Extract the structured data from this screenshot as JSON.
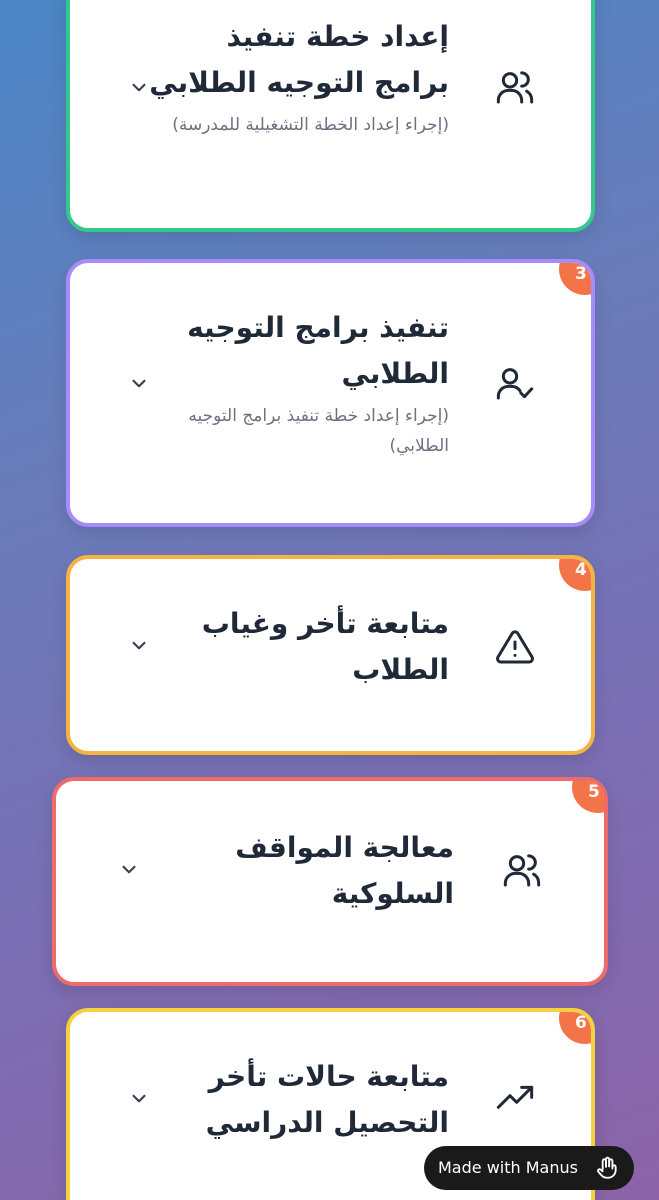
{
  "cards": [
    {
      "badge": "",
      "title": "إعداد خطة تنفيذ برامج التوجيه الطلابي",
      "subtitle": "(إجراء إعداد الخطة التشغيلية للمدرسة)",
      "icon": "users-icon",
      "border_color": "#34c98a"
    },
    {
      "badge": "3",
      "title": "تنفيذ برامج التوجيه الطلابي",
      "subtitle": "(إجراء إعداد خطة تنفيذ برامج التوجيه الطلابي)",
      "icon": "user-check-icon",
      "border_color": "#a78bfa"
    },
    {
      "badge": "4",
      "title": "متابعة تأخر وغياب الطلاب",
      "subtitle": "",
      "icon": "warning-icon",
      "border_color": "#f5b342"
    },
    {
      "badge": "5",
      "title": "معالجة المواقف السلوكية",
      "subtitle": "",
      "icon": "users-icon",
      "border_color": "#ef6b6b"
    },
    {
      "badge": "6",
      "title": "متابعة حالات تأخر التحصيل الدراسي",
      "subtitle": "",
      "icon": "trending-up-icon",
      "border_color": "#f5d142"
    }
  ],
  "made_with": {
    "label": "Made with Manus"
  },
  "colors": {
    "badge": "#f4744a",
    "title": "#1f2937",
    "subtitle": "#6b7280"
  }
}
